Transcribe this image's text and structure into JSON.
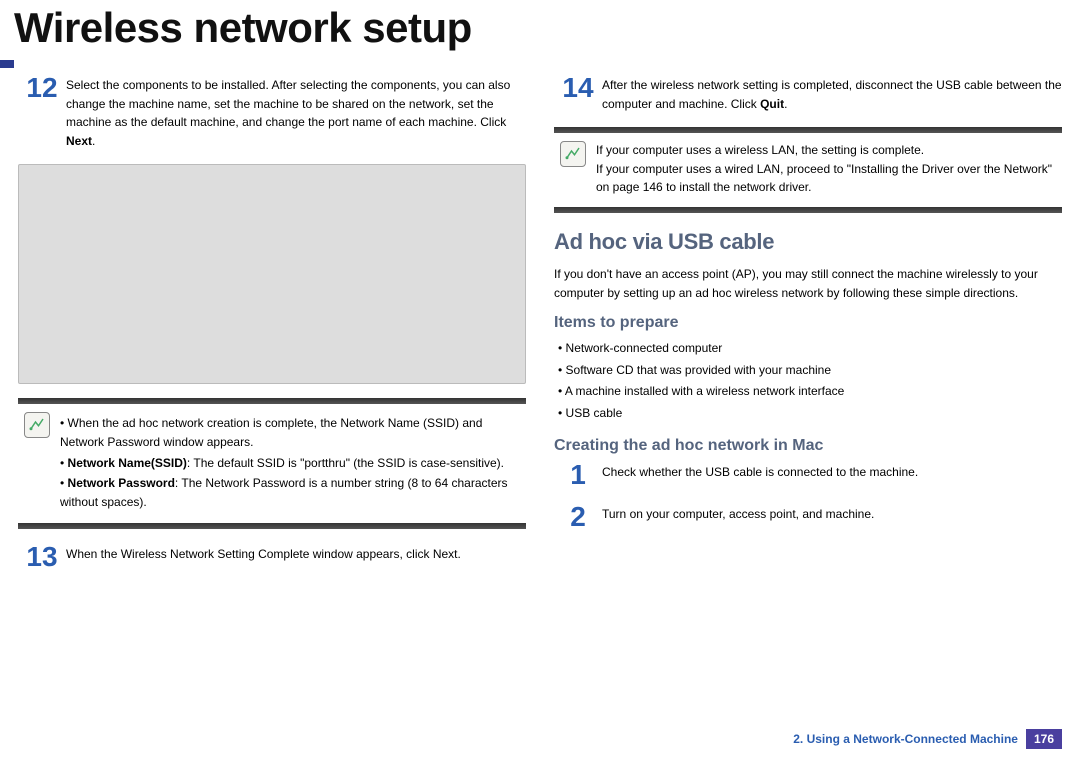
{
  "header": {
    "title": "Wireless network setup"
  },
  "left": {
    "step12_num": "12",
    "step12_text": "Select the components to be installed. After selecting the components, you can also change the machine name, set the machine to be shared on the network, set the machine as the default machine, and change the port name of each machine. Click ",
    "step12_bold": "Next",
    "step12_end": ".",
    "note1_intro": "When the ad hoc network creation is complete, the Network Name (SSID) and Network Password window appears.",
    "note1_bullet1_label": "Network Name(SSID)",
    "note1_bullet1_text": ": The default SSID is \"portthru\" (the SSID is case-sensitive).",
    "note1_bullet2_label": "Network Password",
    "note1_bullet2_text": ": The Network Password is a number string (8 to 64 characters without spaces).",
    "step13_num": "13",
    "step13_text": "When the Wireless Network Setting Complete window appears, click Next."
  },
  "right": {
    "step14_num": "14",
    "step14_text": "After the wireless network setting is completed, disconnect the USB cable between the computer and machine. Click ",
    "step14_bold": "Quit",
    "step14_end": ".",
    "note2_line1": "If your computer uses a wireless LAN, the setting is complete.",
    "note2_line2": "If your computer uses a wired LAN, proceed to \"Installing the Driver over the Network\" on page 146 to install the network driver.",
    "note2_ref": "page 146",
    "h1": "Ad hoc via USB cable",
    "adhoc_para": "If you don't have an access point (AP), you may still connect the machine wirelessly to your computer by setting up an ad hoc wireless network by following these simple directions.",
    "h2a": "Items to prepare",
    "items": [
      "Network-connected computer",
      "Software CD that was provided with your machine",
      "A machine installed with a wireless network interface",
      "USB cable"
    ],
    "h2b": "Creating the ad hoc network in Mac",
    "step1_num": "1",
    "step1_text": "Check whether the USB cable is connected to the machine.",
    "step2_num": "2",
    "step2_text": "Turn on your computer, access point, and machine."
  },
  "footer": {
    "chapter": "2.  Using a Network-Connected Machine",
    "page": "176"
  }
}
